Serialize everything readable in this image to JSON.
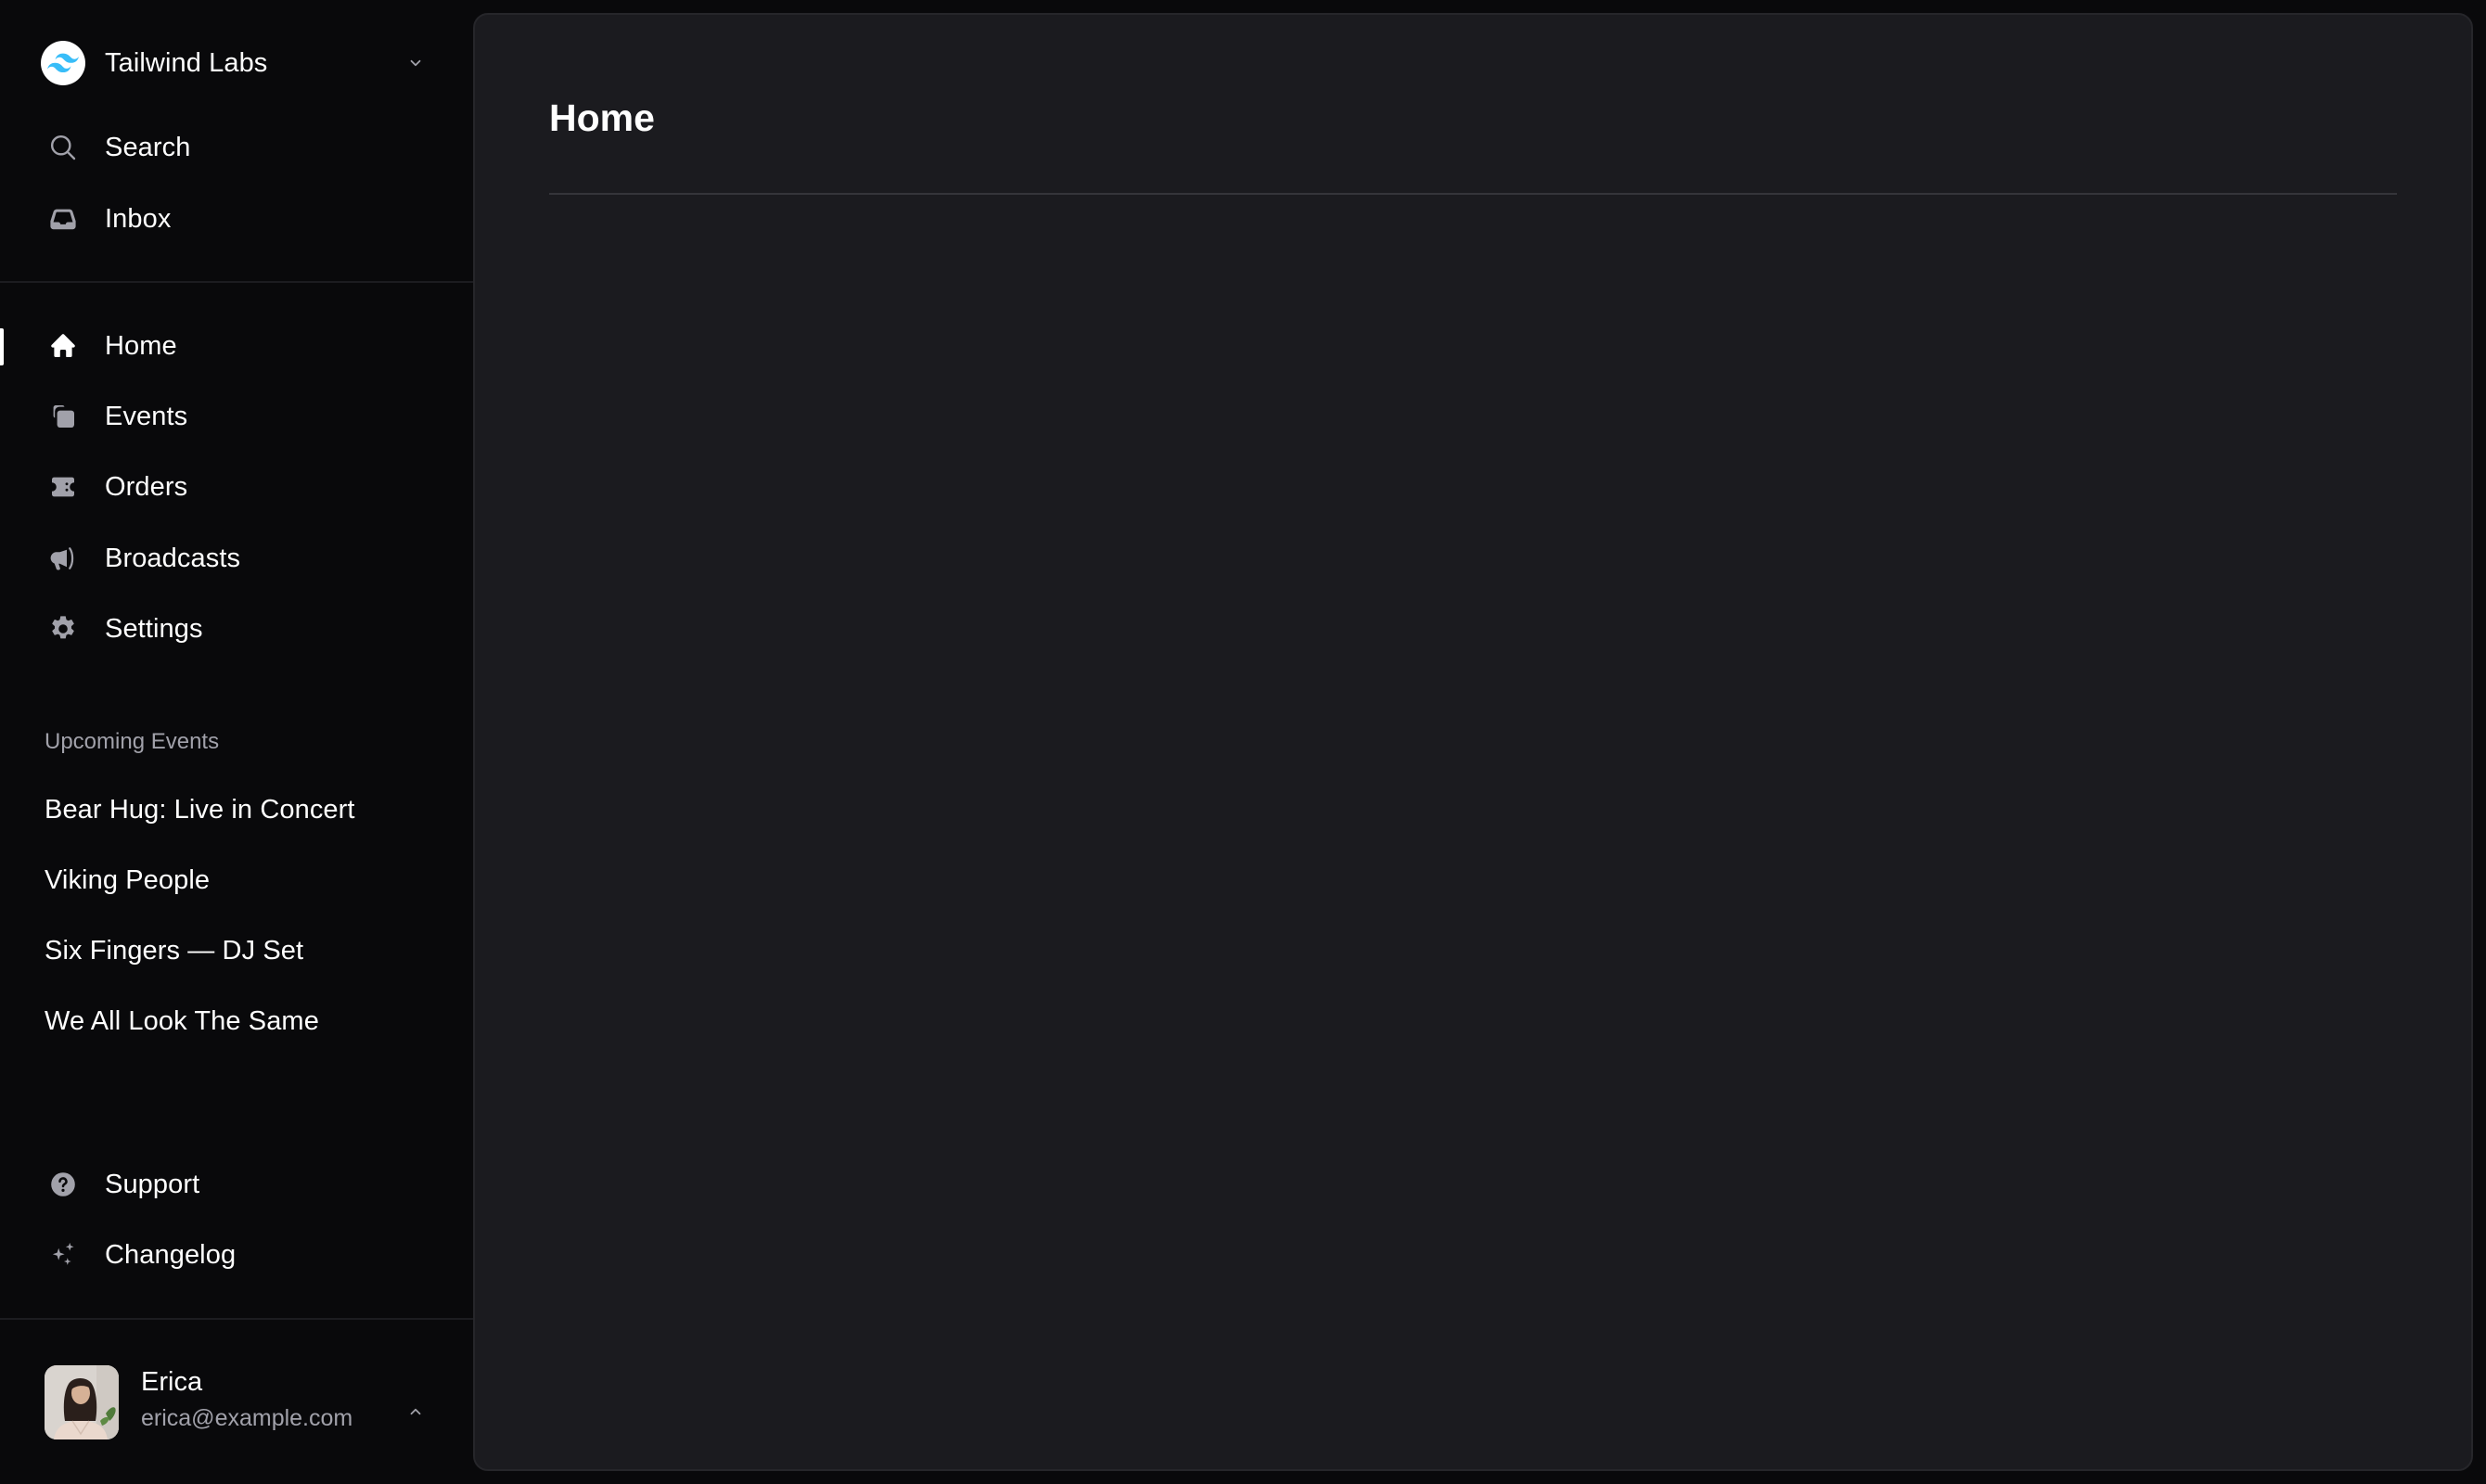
{
  "team": {
    "name": "Tailwind Labs",
    "logo_icon": "tailwind-logo-icon",
    "toggle_icon": "chevron-down-icon"
  },
  "top_nav": [
    {
      "label": "Search",
      "icon": "search-icon"
    },
    {
      "label": "Inbox",
      "icon": "inbox-icon"
    }
  ],
  "main_nav": [
    {
      "label": "Home",
      "icon": "home-icon",
      "active": true
    },
    {
      "label": "Events",
      "icon": "events-icon",
      "active": false
    },
    {
      "label": "Orders",
      "icon": "ticket-icon",
      "active": false
    },
    {
      "label": "Broadcasts",
      "icon": "megaphone-icon",
      "active": false
    },
    {
      "label": "Settings",
      "icon": "gear-icon",
      "active": false
    }
  ],
  "upcoming_events": {
    "heading": "Upcoming Events",
    "items": [
      {
        "label": "Bear Hug: Live in Concert"
      },
      {
        "label": "Viking People"
      },
      {
        "label": "Six Fingers — DJ Set"
      },
      {
        "label": "We All Look The Same"
      }
    ]
  },
  "footer_nav": [
    {
      "label": "Support",
      "icon": "question-circle-icon"
    },
    {
      "label": "Changelog",
      "icon": "sparkles-icon"
    }
  ],
  "user": {
    "name": "Erica",
    "email": "erica@example.com",
    "menu_icon": "chevron-up-icon"
  },
  "page": {
    "title": "Home"
  },
  "colors": {
    "background": "#09090b",
    "panel": "#1b1b1f",
    "icon": "#a1a1aa",
    "muted_text": "#a1a1aa",
    "brand": "#38bdf8"
  }
}
